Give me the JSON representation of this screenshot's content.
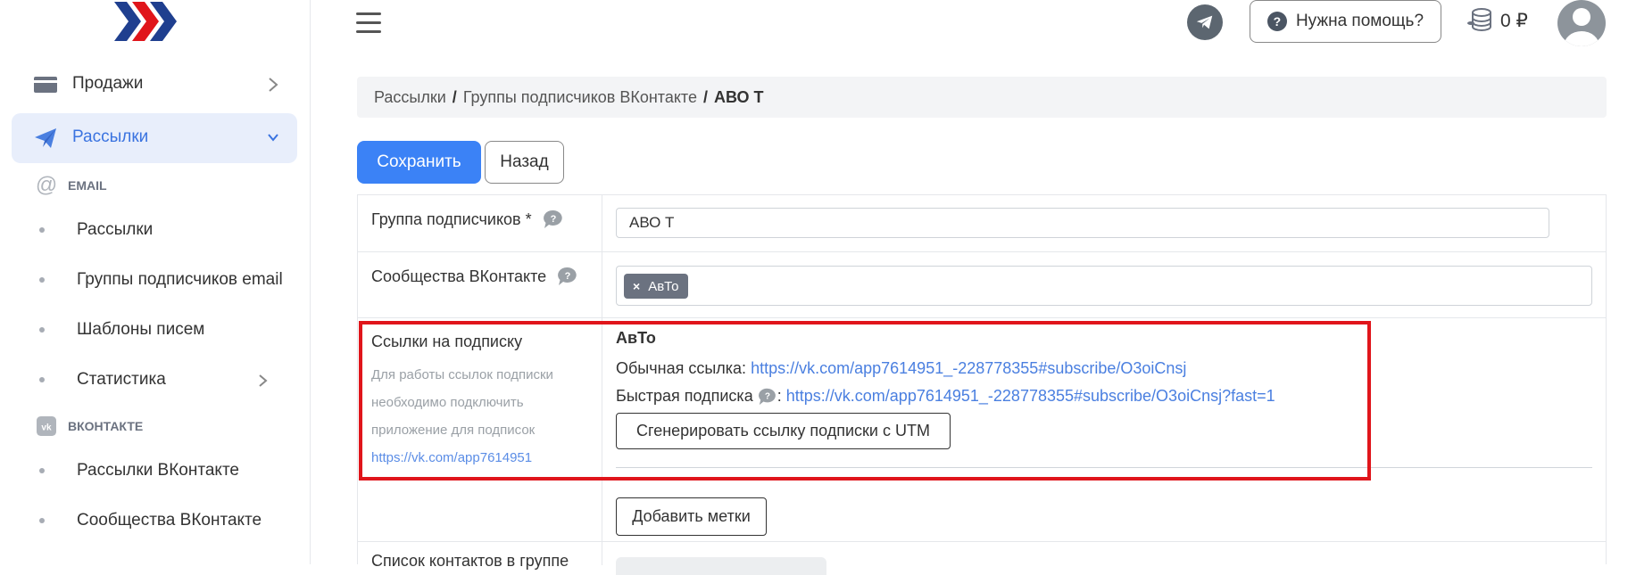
{
  "sidebar": {
    "menu": [
      {
        "label": "Продажи",
        "icon": "credit-card-icon",
        "expanded": false
      },
      {
        "label": "Рассылки",
        "icon": "paper-plane-icon",
        "expanded": true,
        "active": true
      }
    ],
    "sections": [
      {
        "title": "EMAIL",
        "icon": "at-sign-icon",
        "items": [
          {
            "label": "Рассылки"
          },
          {
            "label": "Группы подписчиков email"
          },
          {
            "label": "Шаблоны писем"
          },
          {
            "label": "Статистика",
            "has_submenu": true
          }
        ]
      },
      {
        "title": "ВКОНТАКТЕ",
        "icon": "vk-icon",
        "items": [
          {
            "label": "Рассылки ВКонтакте"
          },
          {
            "label": "Сообщества ВКонтакте"
          }
        ]
      }
    ]
  },
  "topbar": {
    "help_label": "Нужна помощь?",
    "balance": "0 ₽"
  },
  "breadcrumb": {
    "items": [
      "Рассылки",
      "Группы подписчиков ВКонтакте"
    ],
    "separator": "/",
    "current": "АВО Т"
  },
  "actions": {
    "save_label": "Сохранить",
    "back_label": "Назад"
  },
  "form": {
    "group": {
      "label": "Группа подписчиков *",
      "value": "АВО Т"
    },
    "communities": {
      "label": "Сообщества ВКонтакте",
      "tags": [
        "АвТо"
      ]
    },
    "subscribe_links": {
      "label": "Ссылки на подписку",
      "help_lines": [
        "Для работы ссылок подписки",
        "необходимо подключить",
        "приложение для подписок"
      ],
      "help_link": "https://vk.com/app7614951",
      "community_name": "АвТо",
      "regular_label": "Обычная ссылка:",
      "regular_url": "https://vk.com/app7614951_-228778355#subscribe/O3oiCnsj",
      "fast_label": "Быстрая подписка",
      "fast_colon": ":",
      "fast_url": "https://vk.com/app7614951_-228778355#subscribe/O3oiCnsj?fast=1",
      "utm_button": "Сгенерировать ссылку подписки с UTM"
    },
    "add_tags_button": "Добавить метки",
    "contacts_label": "Список контактов в группе"
  },
  "colors": {
    "accent": "#3b82f6",
    "active_bg": "#e8eefb",
    "highlight_border": "#e0151b",
    "link": "#4a7fe0"
  }
}
